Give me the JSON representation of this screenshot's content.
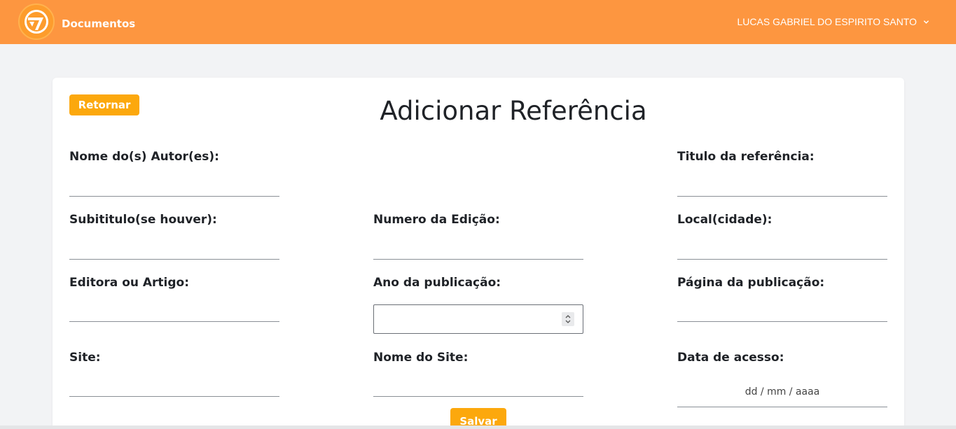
{
  "header": {
    "app_title": "Documentos",
    "user_name": "LUCAS GABRIEL DO ESPIRITO SANTO",
    "accent_color": "#fd9640"
  },
  "form": {
    "back_label": "Retornar",
    "title": "Adicionar Referência",
    "save_label": "Salvar",
    "button_color": "#fca80d",
    "fields": {
      "authors": "Nome do(s) Autor(es):",
      "ref_title": "Titulo da referência:",
      "subtitle": "Subititulo(se houver):",
      "edition": "Numero da Edição:",
      "city": "Local(cidade):",
      "publisher": "Editora ou Artigo:",
      "year": "Ano da publicação:",
      "page": "Página da publicação:",
      "site": "Site:",
      "site_name": "Nome do Site:",
      "access_date": "Data de acesso:"
    },
    "date_placeholder": "dd / mm / aaaa"
  }
}
